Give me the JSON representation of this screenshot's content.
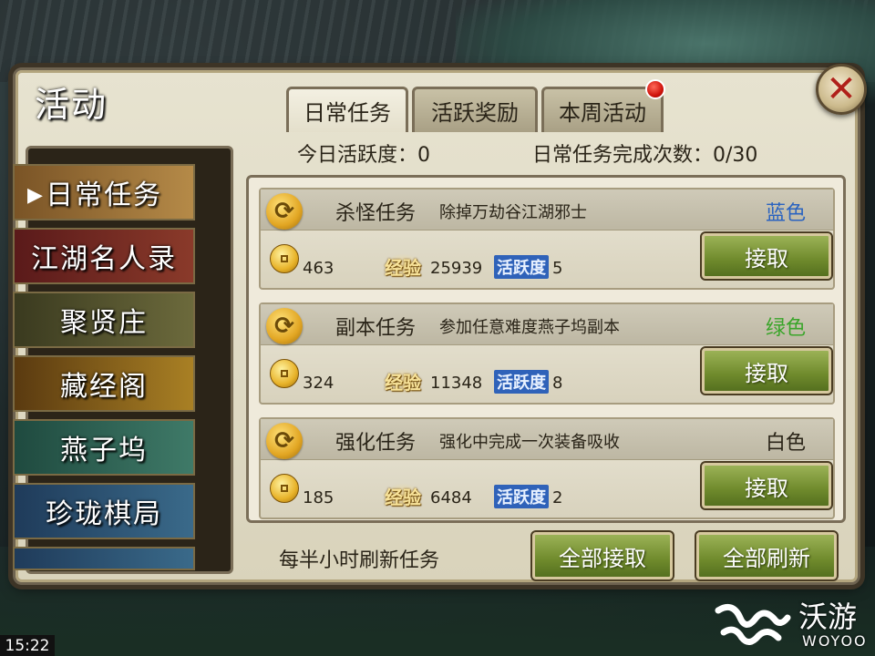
{
  "window": {
    "title": "活动",
    "close_label": "✕"
  },
  "tabs": [
    {
      "label": "日常任务",
      "active": true
    },
    {
      "label": "活跃奖励",
      "active": false
    },
    {
      "label": "本周活动",
      "active": false,
      "has_notification": true
    }
  ],
  "stats": {
    "activity_label": "今日活跃度：0",
    "completion_label": "日常任务完成次数：0/30"
  },
  "menu": {
    "items": [
      {
        "label": "日常任务",
        "selected": true,
        "color": "#5a3a1a"
      },
      {
        "label": "江湖名人录",
        "selected": false,
        "color": "#5a1a1a"
      },
      {
        "label": "聚贤庄",
        "selected": false,
        "color": "#3a3a1f"
      },
      {
        "label": "藏经阁",
        "selected": false,
        "color": "#6a4a12"
      },
      {
        "label": "燕子坞",
        "selected": false,
        "color": "#1f4a3f"
      },
      {
        "label": "珍珑棋局",
        "selected": false,
        "color": "#1f3b5a"
      },
      {
        "label": "",
        "selected": false,
        "color": "#1f3b5a"
      }
    ],
    "selected_arrow": "▶"
  },
  "tasks": [
    {
      "name": "杀怪任务",
      "description": "除掉万劫谷江湖邪士",
      "grade": "蓝色",
      "grade_color": "#2a63c0",
      "gold": "463",
      "exp_label": "经验",
      "exp": "25939",
      "activity_label": "活跃度",
      "activity": "5",
      "accept_label": "接取"
    },
    {
      "name": "副本任务",
      "description": "参加任意难度燕子坞副本",
      "grade": "绿色",
      "grade_color": "#3aa52a",
      "gold": "324",
      "exp_label": "经验",
      "exp": "11348",
      "activity_label": "活跃度",
      "activity": "8",
      "accept_label": "接取"
    },
    {
      "name": "强化任务",
      "description": "强化中完成一次装备吸收",
      "grade": "白色",
      "grade_color": "#2a2418",
      "gold": "185",
      "exp_label": "经验",
      "exp": "6484",
      "activity_label": "活跃度",
      "activity": "2",
      "accept_label": "接取"
    }
  ],
  "footer": {
    "refresh_hint": "每半小时刷新任务",
    "accept_all_label": "全部接取",
    "refresh_all_label": "全部刷新"
  },
  "status_bar": {
    "clock": "15:22"
  },
  "watermark": {
    "cn": "沃游",
    "en": "WOYOO"
  }
}
